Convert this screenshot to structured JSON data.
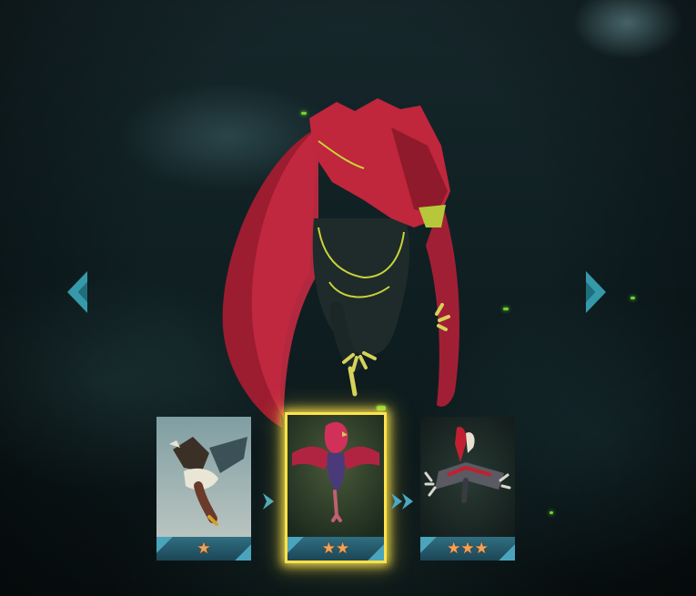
{
  "screen": {
    "background_theme": "dark forest",
    "hero": {
      "icon": "red-bird-creature-figure",
      "accent": "#b8233a",
      "trim": "#c9d33a"
    }
  },
  "navigation": {
    "prev_icon": "chevron-left-icon",
    "next_icon": "chevron-right-icon",
    "color": "#3aa7b8"
  },
  "evolution_cards": [
    {
      "creature_icon": "eagle-icon",
      "stars": 1,
      "star_text": "★",
      "selected": false
    },
    {
      "creature_icon": "red-bird-icon",
      "stars": 2,
      "star_text": "★★",
      "selected": true
    },
    {
      "creature_icon": "armored-bird-icon",
      "stars": 3,
      "star_text": "★★★",
      "selected": false
    }
  ],
  "colors": {
    "star": "#f0a25a",
    "selected_border": "#ffe24a",
    "card_bar": "#2f6f82",
    "evolution_arrow": "#4aa9c2"
  }
}
